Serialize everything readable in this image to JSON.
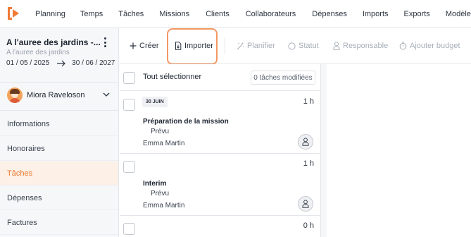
{
  "topnav": {
    "logo_icon": "app-logo-icon",
    "brand_color": "#f07a36",
    "items": [
      "Planning",
      "Temps",
      "Tâches",
      "Missions",
      "Clients",
      "Collaborateurs",
      "Dépenses",
      "Imports",
      "Exports",
      "Modèles"
    ]
  },
  "project": {
    "title": "A l'auree des jardins -...",
    "subtitle": "A l'auree des jardins",
    "start_date": "01 / 05 / 2025",
    "end_date": "30 / 06 / 2027"
  },
  "user": {
    "name": "Miora Raveloson"
  },
  "sidebar": {
    "items": [
      {
        "label": "Informations"
      },
      {
        "label": "Honoraires"
      },
      {
        "label": "Tâches"
      },
      {
        "label": "Dépenses"
      },
      {
        "label": "Factures"
      }
    ],
    "active_index": 2,
    "active_color": "#e8792e"
  },
  "toolbar": {
    "create_label": "Créer",
    "import_label": "Importer",
    "plan_label": "Planifier",
    "status_label": "Statut",
    "responsible_label": "Responsable",
    "budget_label": "Ajouter budget",
    "highlight_color": "#f39862"
  },
  "tasklist": {
    "select_all_label": "Tout sélectionner",
    "modified_count_label": "0 tâches modifiées",
    "groups": [
      {
        "date_label": "30 JUIN",
        "hours": "1 h",
        "task": {
          "title": "Préparation de la mission",
          "status": "Prévu",
          "person": "Emma Martin"
        }
      },
      {
        "date_label": "",
        "hours": "1 h",
        "task": {
          "title": "Interim",
          "status": "Prévu",
          "person": "Emma Martin"
        }
      },
      {
        "date_label": "",
        "hours": "0 h"
      }
    ]
  }
}
